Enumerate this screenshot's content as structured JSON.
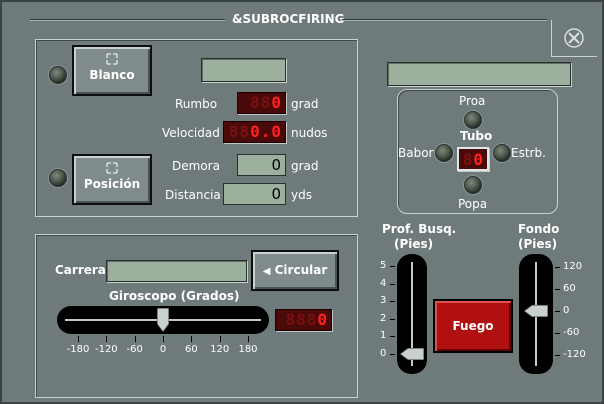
{
  "window": {
    "title": "&SUBROCFIRING"
  },
  "target": {
    "blanco_label": "Blanco",
    "posicion_label": "Posición",
    "rumbo_label": "Rumbo",
    "rumbo_value": "0",
    "rumbo_unit": "grad",
    "velocidad_label": "Velocidad",
    "velocidad_value": "0.0",
    "velocidad_unit": "nudos",
    "demora_label": "Demora",
    "demora_value": "0",
    "demora_unit": "grad",
    "distancia_label": "Distancia",
    "distancia_value": "0",
    "distancia_unit": "yds"
  },
  "tube": {
    "proa": "Proa",
    "tubo": "Tubo",
    "babor": "Babor",
    "estrb": "Estrb.",
    "popa": "Popa",
    "value": "0"
  },
  "run": {
    "carrera_label": "Carrera",
    "circular_label": "Circular",
    "giroscopo_label": "Giroscopo (Grados)",
    "giroscopo_value": "0",
    "giroscopo_level": 0,
    "giro_ticks": [
      "-180",
      "-120",
      "-60",
      "0",
      "60",
      "120",
      "180"
    ]
  },
  "depth": {
    "busq_label_1": "Prof. Busq.",
    "busq_label_2": "(Pies)",
    "busq_ticks": [
      "5",
      "4",
      "3",
      "2",
      "1",
      "0"
    ],
    "busq_level": 0,
    "fondo_label_1": "Fondo",
    "fondo_label_2": "(Pies)",
    "fondo_ticks": [
      "120",
      "60",
      "0",
      "-60",
      "-120"
    ],
    "fondo_level": 0
  },
  "fire": {
    "label": "Fuego"
  }
}
